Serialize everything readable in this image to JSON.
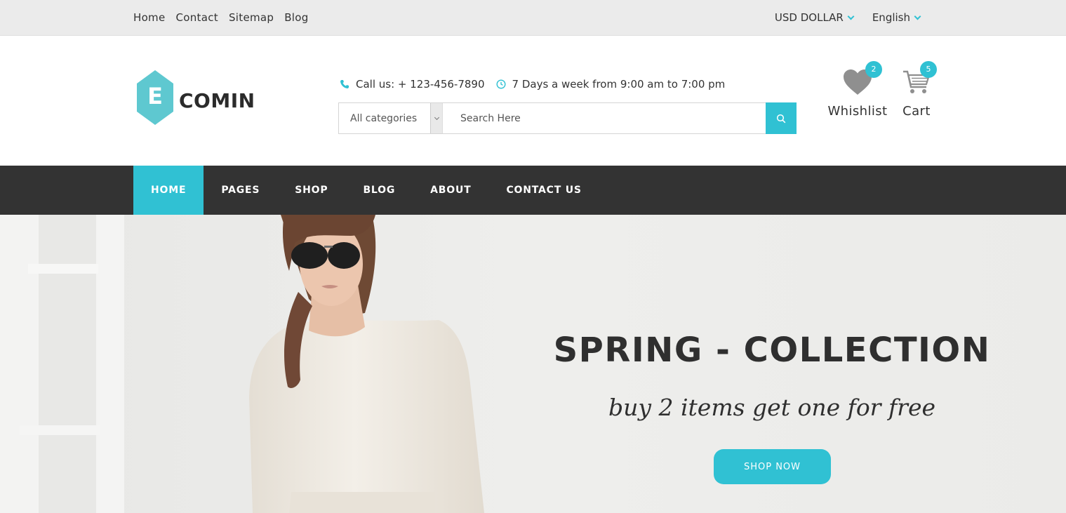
{
  "topbar": {
    "links": [
      "Home",
      "Contact",
      "Sitemap",
      "Blog"
    ],
    "currency": "USD DOLLAR",
    "language": "English"
  },
  "logo": {
    "letter": "E",
    "text": "COMIN"
  },
  "contact": {
    "phone": "Call us: + 123-456-7890",
    "hours": "7 Days a week from 9:00 am to 7:00 pm"
  },
  "search": {
    "category": "All categories",
    "placeholder": "Search Here"
  },
  "wishlist": {
    "label": "Whishlist",
    "count": "2"
  },
  "cart": {
    "label": "Cart",
    "count": "5"
  },
  "nav": {
    "items": [
      "HOME",
      "PAGES",
      "SHOP",
      "BLOG",
      "ABOUT",
      "CONTACT US"
    ],
    "active": "HOME"
  },
  "hero": {
    "title": "SPRING - COLLECTION",
    "subtitle": "buy 2 items get one for free",
    "button": "SHOP NOW"
  },
  "colors": {
    "accent": "#30c1d3",
    "nav_bg": "#333333",
    "topbar_bg": "#ebebeb",
    "text_dark": "#2f2f2f"
  },
  "icons": [
    "phone-icon",
    "clock-icon",
    "search-icon",
    "heart-icon",
    "cart-icon",
    "chevron-down-icon"
  ]
}
